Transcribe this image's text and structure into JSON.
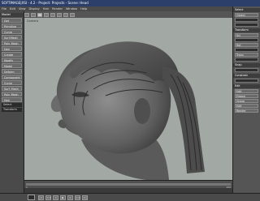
{
  "window": {
    "title": "SOFTIMAGE|XSI - 4.2 - Project: Projects - Scene: Head"
  },
  "menubar": {
    "items": [
      "File",
      "Edit",
      "View",
      "Display",
      "Hair",
      "Render",
      "Window",
      "Help"
    ]
  },
  "left_toolbar": {
    "header": "Model",
    "buttons": [
      "Get",
      "Primitive",
      "Curve",
      "Surf.Mesh",
      "Poly. Mesh",
      "Hair",
      "Create",
      "Modify",
      "Model",
      "Deform",
      "Component",
      "Curve",
      "Surf. Mesh",
      "Poly. Mesh",
      "Hair"
    ],
    "select_labels": [
      "Select",
      "Transform"
    ]
  },
  "viewport": {
    "label": "Camera"
  },
  "right_panel": {
    "header": "Select",
    "sections": [
      "Transform",
      "Snap",
      "Constrain",
      "Edit"
    ],
    "buttons": [
      "Object",
      "Scl",
      "Rot",
      "Trans",
      "Edit",
      "Freeze",
      "Group",
      "Edit",
      "Render"
    ]
  },
  "timeline": {
    "start": "1",
    "end": "100"
  },
  "playback": {
    "buttons": [
      "|<",
      "<<",
      "<",
      "▶",
      ">",
      ">>",
      ">|"
    ]
  }
}
